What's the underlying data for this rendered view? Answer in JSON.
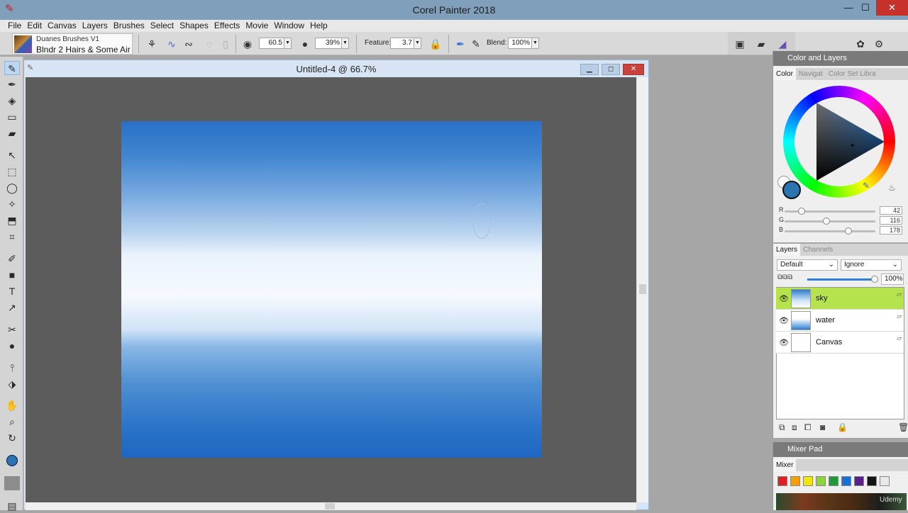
{
  "app": {
    "title": "Corel Painter 2018"
  },
  "window_controls": {
    "minimize": "—",
    "maximize": "☐",
    "close": "✕"
  },
  "menu": [
    "File",
    "Edit",
    "Canvas",
    "Layers",
    "Brushes",
    "Select",
    "Shapes",
    "Effects",
    "Movie",
    "Window",
    "Help"
  ],
  "property_bar": {
    "brush_category": "Duanes Brushes V1",
    "brush_variant": "Blndr 2 Hairs & Some Air",
    "size": "60.5",
    "opacity": "39%",
    "feature_label": "Feature:",
    "feature": "3.7",
    "blend_label": "Blend:",
    "blend": "100%"
  },
  "document": {
    "title": "Untitled-4 @ 66.7%"
  },
  "color_panel": {
    "header": "Color and Layers",
    "tabs": [
      "Color",
      "Navigat",
      "Color Set Libra"
    ],
    "main_color": "#2a74b2",
    "r_label": "R",
    "r": "42",
    "g_label": "G",
    "g": "116",
    "b_label": "B",
    "b": "178"
  },
  "layers_panel": {
    "tabs": [
      "Layers",
      "Channels"
    ],
    "composite_method": "Default",
    "preserve_mode": "Ignore",
    "opacity": "100%",
    "layers": [
      {
        "name": "sky",
        "selected": true
      },
      {
        "name": "water",
        "selected": false
      },
      {
        "name": "Canvas",
        "selected": false
      }
    ]
  },
  "mixer_panel": {
    "header": "Mixer Pad",
    "tab": "Mixer",
    "swatches": [
      "#e02020",
      "#f5a000",
      "#f2e500",
      "#8fd23a",
      "#1e9a3a",
      "#1872d6",
      "#5a1f8a",
      "#151515",
      "#e8e8e8"
    ],
    "watermark": "Udemy"
  }
}
